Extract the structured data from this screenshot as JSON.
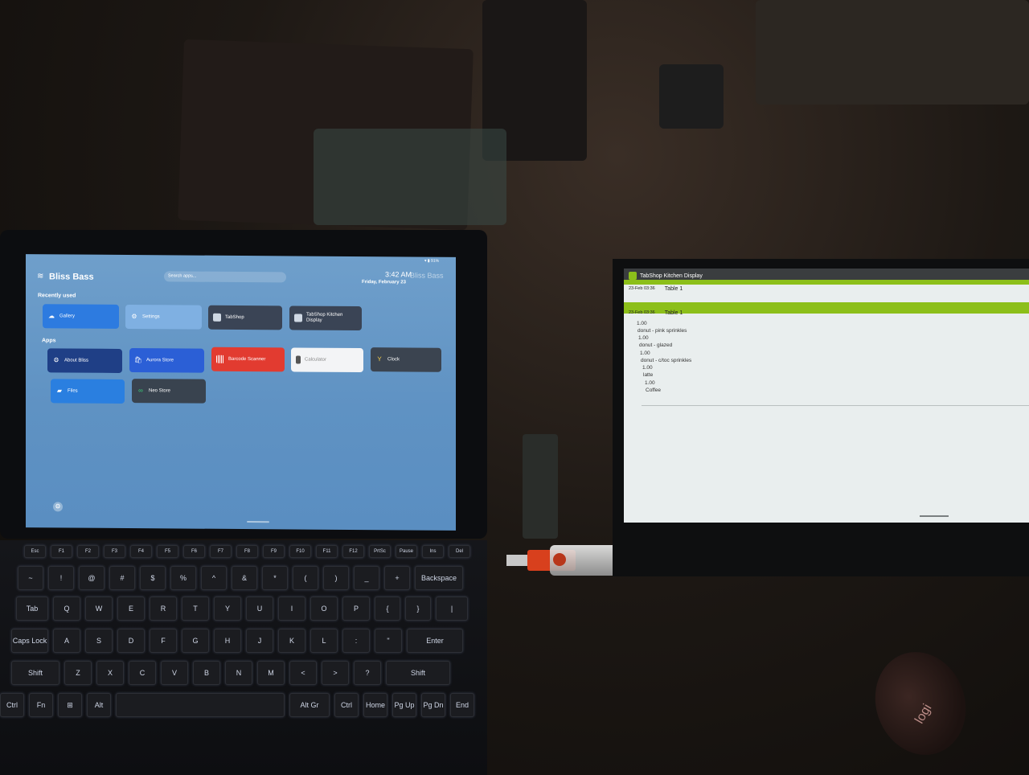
{
  "left_tablet": {
    "statusbar": {
      "battery": "▾ ▮ 91%"
    },
    "app_title": "Bliss Bass",
    "search": {
      "placeholder": "Search apps..."
    },
    "clock": {
      "time": "3:42 AM",
      "date": "Friday, February 23",
      "overlay": "Bliss Bass"
    },
    "recently_used_label": "Recently used",
    "recently_used": [
      {
        "label": "Gallery",
        "color": "#2d7be0"
      },
      {
        "label": "Settings",
        "color": "#7fb0e2"
      },
      {
        "label": "TabShop",
        "color": "#3a4455"
      },
      {
        "label": "TabShop Kitchen Display",
        "color": "#3a4455"
      }
    ],
    "apps_label": "Apps",
    "apps": [
      {
        "label": "About Bliss",
        "color": "#1f3f86"
      },
      {
        "label": "Aurora Store",
        "color": "#2b5fd6"
      },
      {
        "label": "Barcode Scanner",
        "color": "#e23b30"
      },
      {
        "label": "Calculator",
        "color": "#f3f4f6"
      },
      {
        "label": "Clock",
        "color": "#3b4450"
      },
      {
        "label": "Files",
        "color": "#2a7fe0"
      },
      {
        "label": "Neo Store",
        "color": "#39434f"
      }
    ]
  },
  "keyboard": {
    "row0": [
      "Esc",
      "F1",
      "F2",
      "F3",
      "F4",
      "F5",
      "F6",
      "F7",
      "F8",
      "F9",
      "F10",
      "F11",
      "F12",
      "PrtSc",
      "Pause",
      "Ins",
      "Del"
    ],
    "row1": [
      "~",
      "!",
      "@",
      "#",
      "$",
      "%",
      "^",
      "&",
      "*",
      "(",
      ")",
      "_",
      "+",
      "Backspace"
    ],
    "row2": [
      "Tab",
      "Q",
      "W",
      "E",
      "R",
      "T",
      "Y",
      "U",
      "I",
      "O",
      "P",
      "{",
      "}",
      "|"
    ],
    "row3": [
      "Caps Lock",
      "A",
      "S",
      "D",
      "F",
      "G",
      "H",
      "J",
      "K",
      "L",
      ":",
      "\"",
      "Enter"
    ],
    "row4": [
      "Shift",
      "Z",
      "X",
      "C",
      "V",
      "B",
      "N",
      "M",
      "<",
      ">",
      "?",
      "Shift"
    ],
    "row5": [
      "Ctrl",
      "Fn",
      "⊞",
      "Alt",
      "",
      "Alt Gr",
      "Ctrl",
      "Home",
      "Pg Up",
      "Pg Dn",
      "End"
    ]
  },
  "kitchen_display": {
    "title": "TabShop Kitchen Display",
    "orders": [
      {
        "stamp": "23-Feb 03:36",
        "table": "Table 1"
      },
      {
        "stamp": "23-Feb 03:36",
        "table": "Table 1"
      }
    ],
    "items": [
      {
        "qty": "1.00",
        "name": "donut - pink sprinkles"
      },
      {
        "qty": "1.00",
        "name": "donut - glazed"
      },
      {
        "qty": "1.00",
        "name": "donut - c/toc sprinkles"
      },
      {
        "qty": "1.00",
        "name": "latte"
      },
      {
        "qty": "1.00",
        "name": "Coffee"
      }
    ],
    "accent": "#8cbf1a"
  },
  "mouse": {
    "brand": "logi"
  }
}
